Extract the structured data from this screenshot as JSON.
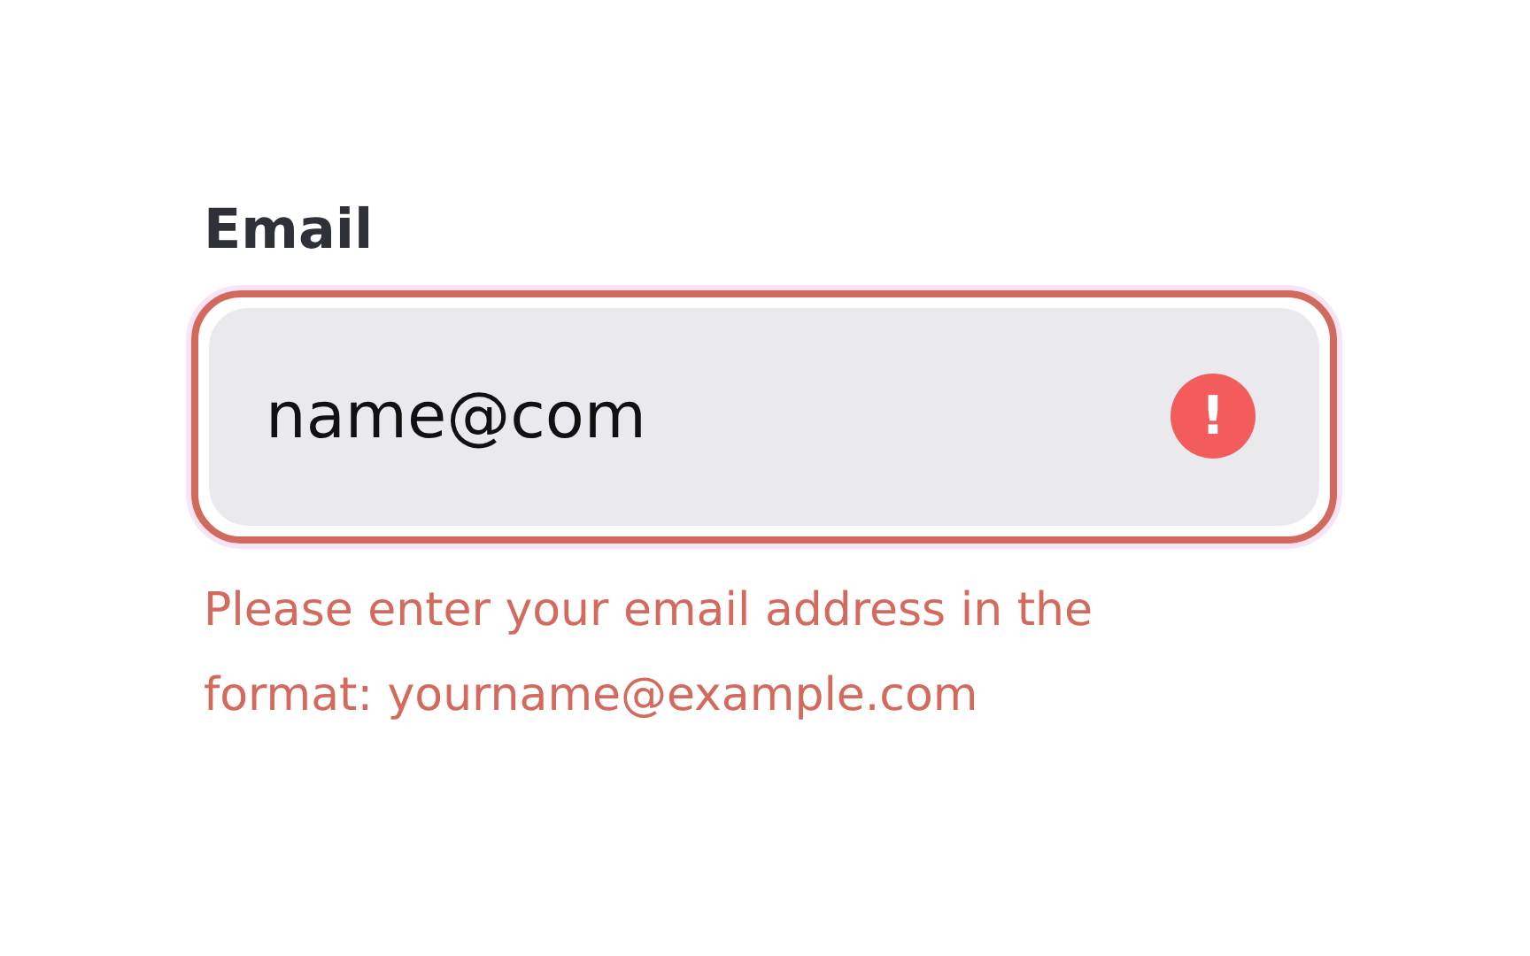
{
  "field": {
    "label": "Email",
    "value": "name@com",
    "invalid": true,
    "error_icon": "!",
    "error": "Please enter your email address in the format: yourname@example.com"
  }
}
